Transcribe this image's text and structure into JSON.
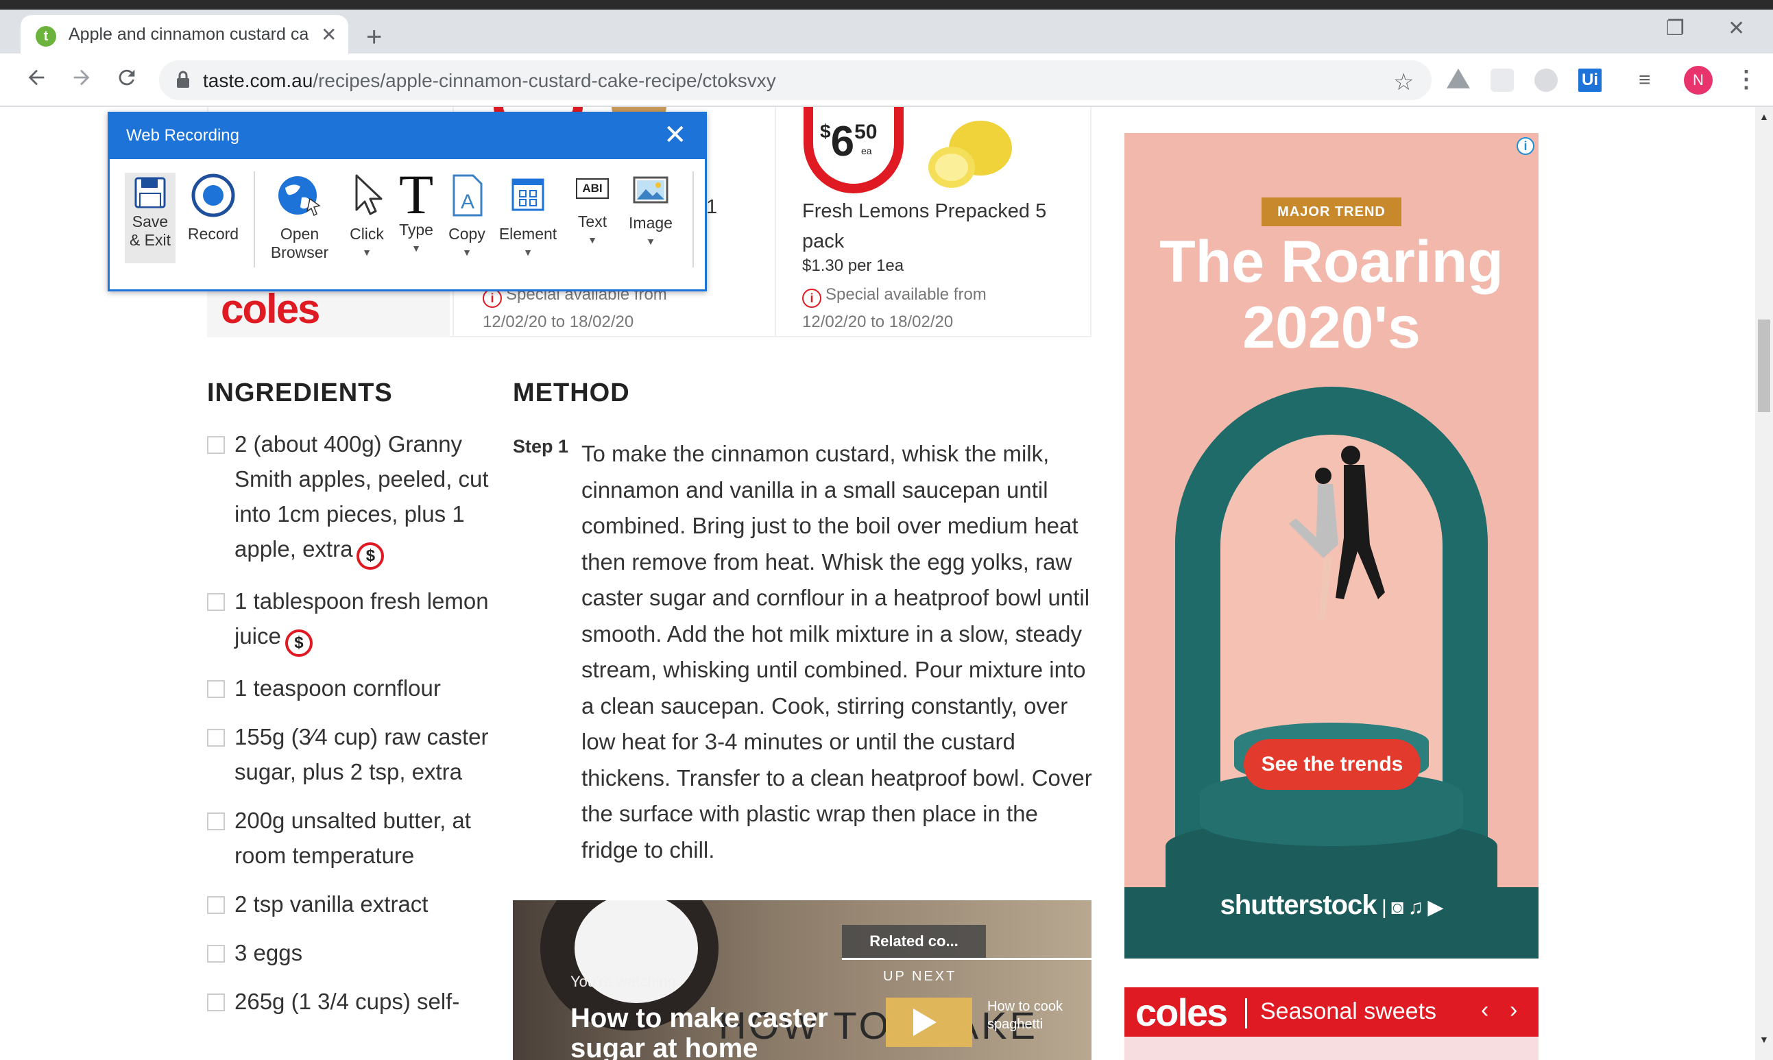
{
  "browser": {
    "tab_title": "Apple and cinnamon custard cak",
    "tab_close": "✕",
    "new_tab": "+",
    "url_host": "taste.com.au",
    "url_path": "/recipes/apple-cinnamon-custard-cake-recipe/ctoksvxy",
    "profile_initial": "N",
    "favicon_letter": "t"
  },
  "web_recording": {
    "title": "Web Recording",
    "close": "✕",
    "buttons": {
      "save": "Save & Exit",
      "record": "Record",
      "open": "Open Browser",
      "click": "Click",
      "type": "Type",
      "copy": "Copy",
      "element": "Element",
      "text": "Text",
      "image": "Image"
    },
    "text_icon": "ABI"
  },
  "promo": {
    "coles": "coles",
    "price_dollar": "$",
    "price_main": "6",
    "price_cents": "50",
    "price_ea": "ea",
    "product_name": "Fresh Lemons Prepacked 5 pack",
    "unit_price": "$1.30 per 1ea",
    "special_left_1": "Special available from",
    "special_left_2": "12/02/20 to 18/02/20",
    "special_right_1": "Special available from",
    "special_right_2": "12/02/20 to 18/02/20",
    "stray": "1"
  },
  "ingredients": {
    "heading": "INGREDIENTS",
    "items": [
      "2 (about 400g) Granny Smith apples, peeled, cut into 1cm pieces, plus 1 apple, extra",
      "1 tablespoon fresh lemon juice",
      "1 teaspoon cornflour",
      "155g (3⁄4 cup) raw caster sugar, plus 2 tsp, extra",
      "200g unsalted butter, at room temperature",
      "2 tsp vanilla extract",
      "3 eggs",
      "265g (1 3/4 cups) self-"
    ],
    "dollar": "$"
  },
  "method": {
    "heading": "METHOD",
    "step_label": "Step 1",
    "step_text": "To make the cinnamon custard, whisk the milk, cinnamon and vanilla in a small saucepan until combined. Bring just to the boil over medium heat then remove from heat. Whisk the egg yolks, raw caster sugar and cornflour in a heatproof bowl until smooth. Add the hot milk mixture in a slow, steady stream, whisking until combined. Pour mixture into a clean saucepan. Cook, stirring constantly, over low heat for 3-4 minutes or until the custard thickens. Transfer to a clean heatproof bowl. Cover the surface with plastic wrap then place in the fridge to chill."
  },
  "video": {
    "watching": "You're watching",
    "title": "How to make caster sugar at home",
    "howto": "HOW TO: MAKE",
    "related": "Related co...",
    "up_next": "UP NEXT",
    "next_title": "How to cook spaghetti"
  },
  "ad": {
    "info": "i",
    "badge": "MAJOR TREND",
    "title": "The Roaring 2020's",
    "cta": "See the trends",
    "brand": "shutterstock"
  },
  "seasonal": {
    "logo": "coles",
    "text": "Seasonal sweets",
    "prev": "‹",
    "next": "›"
  },
  "colors": {
    "coles_red": "#e01a22",
    "uipath_blue": "#1e73d8",
    "ad_teal": "#1f6b6a",
    "ad_pink": "#f2b8ab"
  },
  "icons": [
    "back-arrow-icon",
    "forward-arrow-icon",
    "reload-icon",
    "lock-icon",
    "star-icon",
    "menu-dots-icon",
    "media-queue-icon"
  ]
}
